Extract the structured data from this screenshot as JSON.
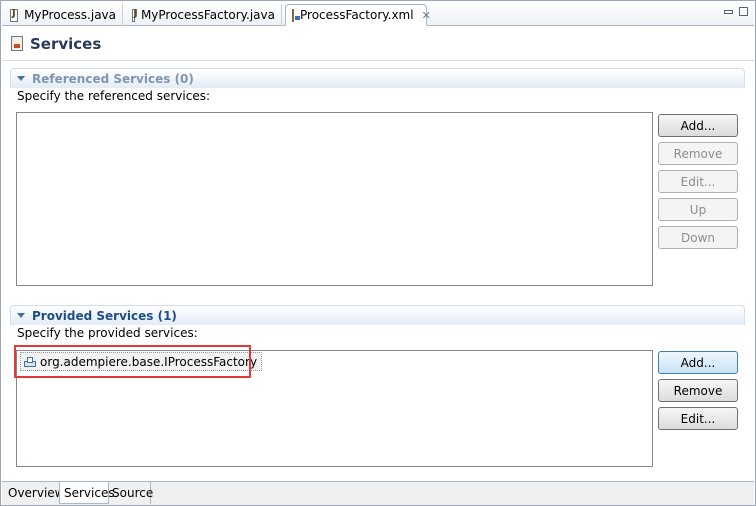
{
  "editor_tabs": [
    {
      "label": "MyProcess.java",
      "icon": "java-file-icon",
      "active": false
    },
    {
      "label": "MyProcessFactory.java",
      "icon": "java-file-icon",
      "active": false
    },
    {
      "label": "ProcessFactory.xml",
      "icon": "xml-file-icon",
      "active": true,
      "close_glyph": "✕"
    }
  ],
  "form": {
    "title": "Services",
    "icon": "component-definition-icon"
  },
  "referenced": {
    "title": "Referenced Services (0)",
    "description": "Specify the referenced services:",
    "items": [],
    "buttons": {
      "add": "Add...",
      "remove": "Remove",
      "edit": "Edit...",
      "up": "Up",
      "down": "Down"
    }
  },
  "provided": {
    "title": "Provided Services (1)",
    "description": "Specify the provided services:",
    "items": [
      {
        "label": "org.adempiere.base.IProcessFactory",
        "icon": "service-interface-icon"
      }
    ],
    "buttons": {
      "add": "Add...",
      "remove": "Remove",
      "edit": "Edit..."
    }
  },
  "bottom_tabs": [
    {
      "label": "Overview",
      "active": false
    },
    {
      "label": "Services",
      "active": true
    },
    {
      "label": "Source",
      "active": false
    }
  ],
  "colors": {
    "section_title_active": "#1f4e87",
    "section_title_inactive": "#7f95b0",
    "highlight": "#e23a3a"
  }
}
